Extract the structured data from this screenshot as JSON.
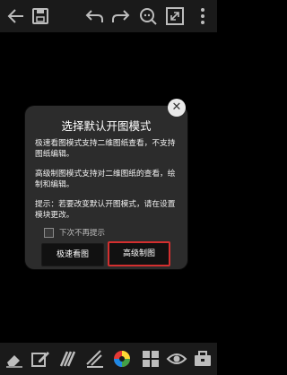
{
  "toolbar": {
    "icons": [
      "back-arrow-icon",
      "save-icon",
      "undo-icon",
      "redo-icon",
      "zoom-icon",
      "fullscreen-icon",
      "more-icon"
    ]
  },
  "dialog": {
    "title": "选择默认开图模式",
    "text1": "极速看图模式支持二维图纸查看，不支持图纸编辑。",
    "text2": "高级制图模式支持对二维图纸的查看，绘制和编辑。",
    "text3": "提示：若要改变默认开图模式，请在设置模块更改。",
    "checkbox_label": "下次不再提示",
    "checkbox_checked": false,
    "btn_fast": "极速看图",
    "btn_advanced": "高级制图",
    "close_symbol": "✕",
    "highlight_color": "#d32f2f"
  },
  "bottombar": {
    "icons": [
      "eraser-icon",
      "edit-icon",
      "layers-icon",
      "measure-icon",
      "color-wheel-icon",
      "blocks-icon",
      "view-icon",
      "toolbox-icon"
    ]
  }
}
